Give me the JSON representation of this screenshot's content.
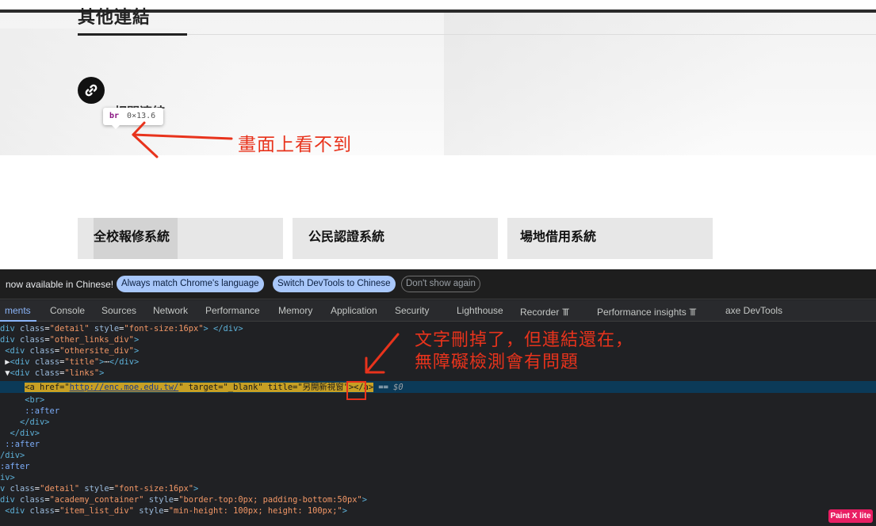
{
  "page": {
    "section_title": "其他連結",
    "related_links_text": "相關連結",
    "tooltip": {
      "tag": "br",
      "dimensions": "0×13.6"
    },
    "annotation_top": "畫面上看不到",
    "annotation_bottom_line1": "文字刪掉了，但連結還在，",
    "annotation_bottom_line2": "無障礙檢測會有問題",
    "system_buttons": [
      {
        "label": "全校報修系統"
      },
      {
        "label": "公民認證系統"
      },
      {
        "label": "場地借用系統"
      }
    ]
  },
  "devtools": {
    "infobar": {
      "text": "now available in Chinese!",
      "buttons": [
        "Always match Chrome's language",
        "Switch DevTools to Chinese",
        "Don't show again"
      ]
    },
    "tabs": [
      "ments",
      "Console",
      "Sources",
      "Network",
      "Performance",
      "Memory",
      "Application",
      "Security",
      "Lighthouse",
      "Recorder 𝍰",
      "Performance insights 𝍰",
      "axe DevTools"
    ],
    "dom_lines": [
      "div class=\"detail\" style=\"font-size:16px\"> </div>",
      "div class=\"other_links_div\">",
      " <div class=\"othersite_div\">",
      " ▶<div class=\"title\">⋯</div>",
      " ▼<div class=\"links\">",
      "     <a href=\"http://enc.moe.edu.tw/\" target=\"_blank\" title=\"另開新視窗\"></a> == $0",
      "     <br>",
      "     ::after",
      "    </div>",
      "  </div>",
      " ::after",
      "/div>",
      ":after",
      "iv>",
      "v class=\"detail\" style=\"font-size:16px\">",
      "div class=\"academy_container\" style=\"border-top:0px; padding-bottom:50px\">",
      " <div class=\"item_list_div\" style=\"min-height: 100px; height: 100px;\">"
    ],
    "selected_line_index": 5
  },
  "badge": "Paint X lite"
}
